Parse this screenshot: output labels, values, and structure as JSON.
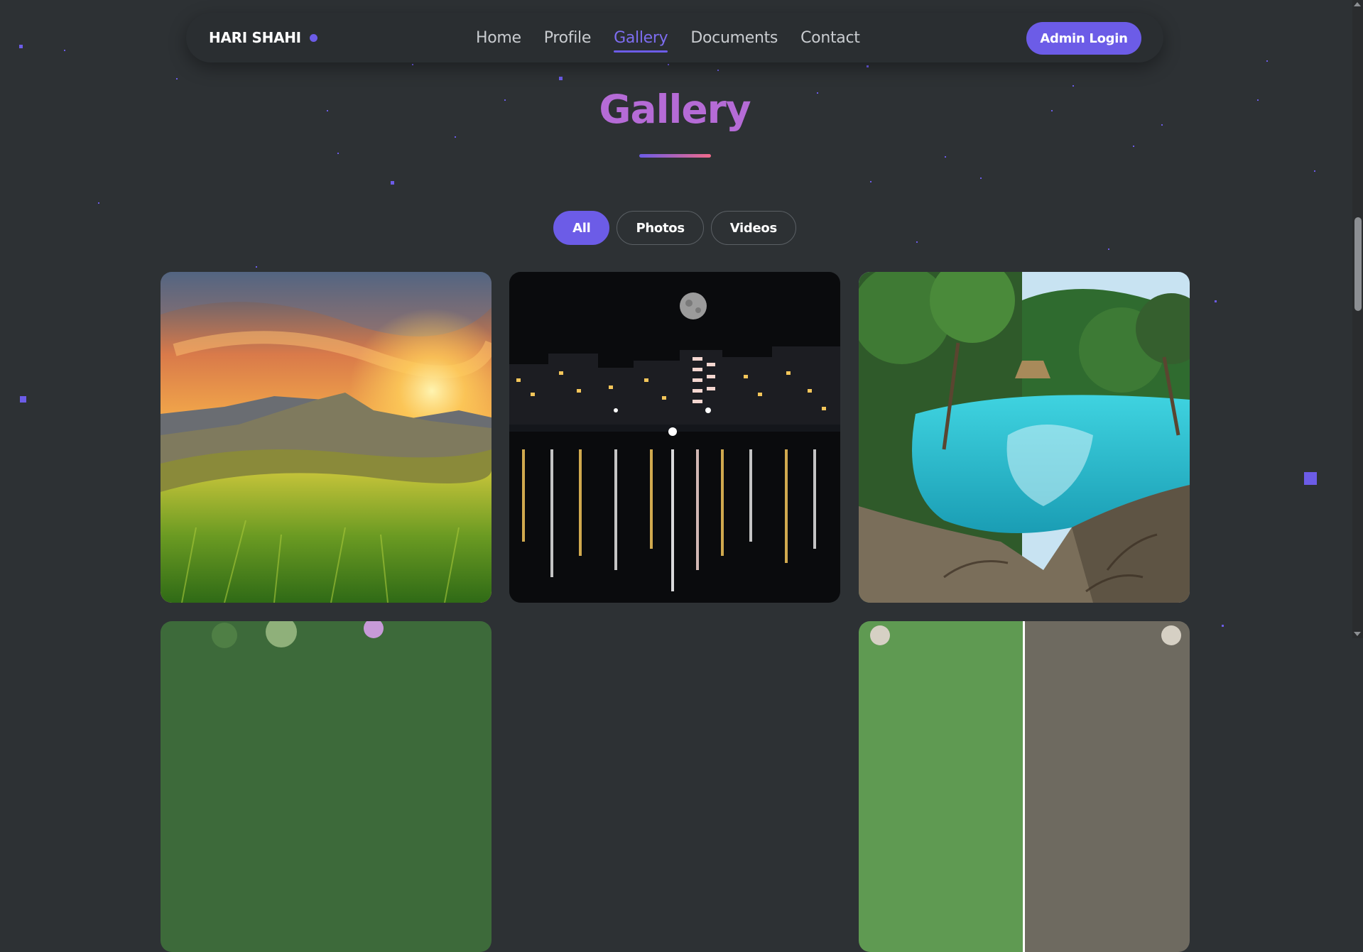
{
  "brand": {
    "name": "HARI SHAHI"
  },
  "nav": {
    "links": [
      "Home",
      "Profile",
      "Gallery",
      "Documents",
      "Contact"
    ],
    "active": "Gallery",
    "admin_label": "Admin Login"
  },
  "page": {
    "title": "Gallery"
  },
  "filters": {
    "items": [
      "All",
      "Photos",
      "Videos"
    ],
    "active": "All"
  },
  "gallery": {
    "items": [
      {
        "icon": "sunset-mountain-meadow-image"
      },
      {
        "icon": "night-city-lake-moon-image"
      },
      {
        "icon": "turquoise-jungle-lagoon-image"
      },
      {
        "icon": "flower-image"
      },
      {
        "icon": "animal-photo-image"
      }
    ]
  },
  "colors": {
    "accent": "#6c5ce7",
    "background": "#2d3134",
    "title": "#b56bd6"
  }
}
